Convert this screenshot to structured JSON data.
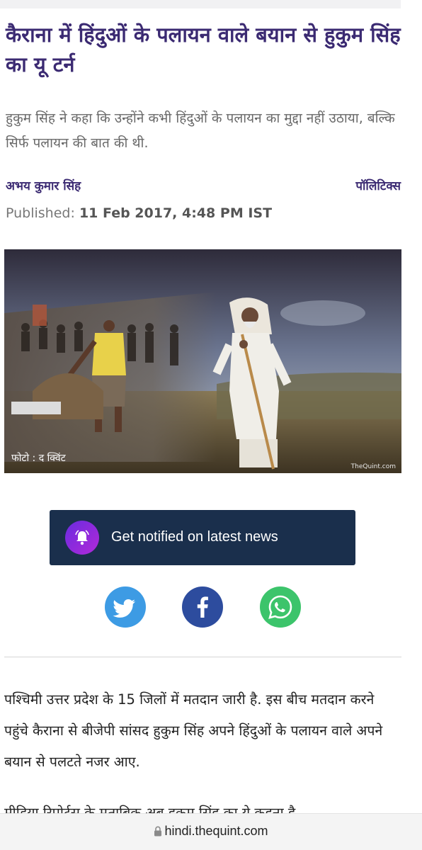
{
  "article": {
    "headline": "कैराना में हिंदुओं के पलायन वाले बयान से हुकुम सिंह का यू टर्न",
    "summary": "हुकुम सिंह ने कहा कि उन्होंने कभी हिंदुओं के पलायन का मुद्दा नहीं उठाया, बल्कि सिर्फ पलायन की बात की थी.",
    "author": "अभय कुमार सिंह",
    "category": "पॉलिटिक्स",
    "published_label": "Published:",
    "published_date": "11 Feb 2017, 4:48 PM IST",
    "image_caption": "फोटो : द क्विंट",
    "image_watermark": "TheQuint.com",
    "paragraph_1": "पश्चिमी उत्तर प्रदेश के 15 जिलों में मतदान जारी है. इस बीच मतदान करने पहुंचे कैराना से बीजेपी सांसद हुकुम सिंह अपने हिंदुओं के पलायन वाले अपने बयान से पलटते नजर आए.",
    "paragraph_2_partial": "मीडिया रिपोर्ट्स के मुताबिक अब हुकुम सिंह का ये कहना है"
  },
  "notify": {
    "label": "Get notified on latest news",
    "icon": "bell-icon",
    "colors": {
      "background": "#1a2f4c",
      "icon_gradient_start": "#6a2be0",
      "icon_gradient_end": "#b12ad8"
    }
  },
  "share": [
    {
      "name": "twitter",
      "icon": "twitter-icon",
      "color": "#3d9be4"
    },
    {
      "name": "facebook",
      "icon": "facebook-icon",
      "color": "#2d4c9e"
    },
    {
      "name": "whatsapp",
      "icon": "whatsapp-icon",
      "color": "#3cc46b"
    }
  ],
  "browser": {
    "url": "hindi.thequint.com",
    "icon": "lock-icon"
  },
  "theme": {
    "accent": "#3b2a72",
    "muted_text": "#686868"
  }
}
